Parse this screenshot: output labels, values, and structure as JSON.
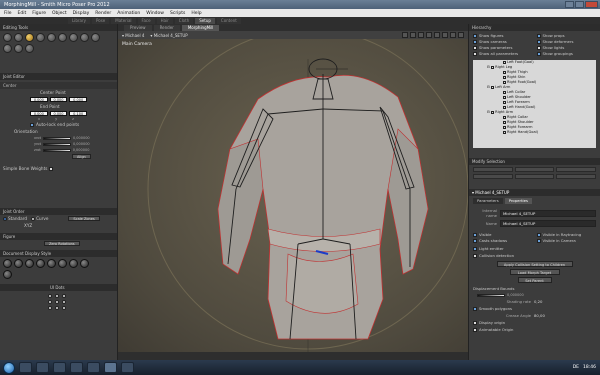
{
  "window": {
    "title": "MorphingMill - Smith Micro Poser Pro 2012"
  },
  "menubar": {
    "items": [
      "File",
      "Edit",
      "Figure",
      "Object",
      "Display",
      "Render",
      "Animation",
      "Window",
      "Scripts",
      "Help"
    ]
  },
  "top_tabs": {
    "items": [
      "Library",
      "Pose",
      "Material",
      "Face",
      "Hair",
      "Cloth",
      "Setup",
      "Content"
    ],
    "active": "Setup"
  },
  "left_panel": {
    "editing_tools_title": "Editing Tools",
    "joint_editor_title": "Joint Editor",
    "joint_section": "Center",
    "center_point_label": "Center Point",
    "center_point": [
      "0,000",
      "0,000",
      "0,000"
    ],
    "end_point_label": "End Point",
    "end_point": [
      "0,000",
      "0,000",
      "0,100"
    ],
    "axis_labels": [
      "x",
      "y",
      "z"
    ],
    "auto_end_point_label": "Auto-lock end points",
    "orientation_label": "Orientation",
    "orientation": [
      {
        "axis": "xrot",
        "value": "0,000000"
      },
      {
        "axis": "yrot",
        "value": "0,000000"
      },
      {
        "axis": "zrot",
        "value": "0,000000"
      }
    ],
    "align_button": "Align",
    "simple_bone_weights_label": "Simple Bone Weights",
    "joint_order_title": "Joint Order",
    "joint_order_options": [
      "Standard",
      "Curve"
    ],
    "joint_order_value": "XYZ",
    "scale_zones_button": "Scale Zones",
    "figure_title": "Figure",
    "zero_rotations_button": "Zero Rotations",
    "doc_display_style_title": "Document Display Style",
    "ui_dots_title": "UI Dots"
  },
  "viewport": {
    "tabs": [
      "Preview",
      "Render",
      "MorphingMill"
    ],
    "active_tab": "MorphingMill",
    "figure_select": "Michael 4",
    "actor_select": "Michael 4_SETUP",
    "camera_label": "Main Camera"
  },
  "right_panel": {
    "hierarchy_title": "Hierarchy",
    "options": [
      {
        "label": "Show figures",
        "checked": true
      },
      {
        "label": "Show props",
        "checked": true
      },
      {
        "label": "Show cameras",
        "checked": true
      },
      {
        "label": "Show deformers",
        "checked": true
      },
      {
        "label": "Show parameters",
        "checked": false
      },
      {
        "label": "Show lights",
        "checked": false
      },
      {
        "label": "Show all parameters",
        "checked": false
      },
      {
        "label": "Show groupings",
        "checked": true
      }
    ],
    "tree": [
      {
        "label": "Left Foot(Goal)",
        "depth": 3,
        "box": false
      },
      {
        "label": "Right Leg",
        "depth": 2,
        "box": true
      },
      {
        "label": "Right Thigh",
        "depth": 3,
        "box": false
      },
      {
        "label": "Right Shin",
        "depth": 3,
        "box": false
      },
      {
        "label": "Right Foot(Goal)",
        "depth": 3,
        "box": false
      },
      {
        "label": "Left Arm",
        "depth": 2,
        "box": true
      },
      {
        "label": "Left Collar",
        "depth": 3,
        "box": false
      },
      {
        "label": "Left Shoulder",
        "depth": 3,
        "box": false
      },
      {
        "label": "Left Forearm",
        "depth": 3,
        "box": false
      },
      {
        "label": "Left Hand(Goal)",
        "depth": 3,
        "box": false
      },
      {
        "label": "Right Arm",
        "depth": 2,
        "box": true
      },
      {
        "label": "Right Collar",
        "depth": 3,
        "box": false
      },
      {
        "label": "Right Shoulder",
        "depth": 3,
        "box": false
      },
      {
        "label": "Right Forearm",
        "depth": 3,
        "box": false
      },
      {
        "label": "Right Hand(Goal)",
        "depth": 3,
        "box": false
      }
    ],
    "modify_selection_title": "Modify Selection",
    "properties_header": "Michael 4_SETUP",
    "prop_tabs": [
      "Parameters",
      "Properties"
    ],
    "active_prop_tab": "Properties",
    "internal_name_label": "Internal name",
    "internal_name": "Michael 4_SETUP",
    "name_label": "Name",
    "name": "Michael 4_SETUP",
    "visibility": [
      {
        "label": "Visible",
        "checked": true
      },
      {
        "label": "Visible in Raytracing",
        "checked": true
      },
      {
        "label": "Casts shadows",
        "checked": true
      },
      {
        "label": "Visible in Camera",
        "checked": true
      }
    ],
    "light_emitter_label": "Light emitter",
    "collision_detection_label": "Collision detection",
    "apply_collision_button": "Apply Collision Setting to Children",
    "load_morph_button": "Load Morph Target",
    "set_parent_button": "Set Parent",
    "displacement_bounds_label": "Displacement Bounds",
    "displacement_bounds_value": "0,000000",
    "shading_rate_label": "Shading rate",
    "shading_rate_value": "0,20",
    "smooth_polygons_label": "Smooth polygons",
    "crease_angle_label": "Crease Angle",
    "crease_angle_value": "80,00",
    "display_origin_label": "Display origin",
    "animatable_origin_label": "Animatable Origin"
  },
  "taskbar": {
    "lang": "DE",
    "time": "18:46"
  }
}
